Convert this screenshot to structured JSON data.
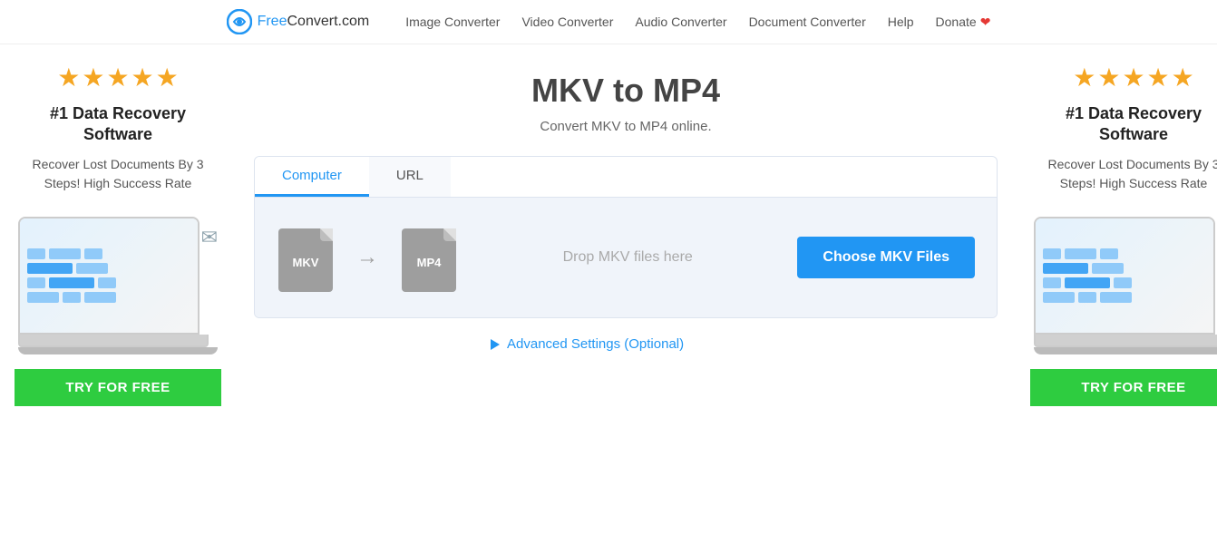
{
  "header": {
    "logo": {
      "free": "Free",
      "convert": "Convert",
      "domain": ".com"
    },
    "nav": {
      "image_converter": "Image Converter",
      "video_converter": "Video Converter",
      "audio_converter": "Audio Converter",
      "document_converter": "Document Converter",
      "help": "Help",
      "donate": "Donate"
    }
  },
  "left_ad": {
    "stars": 4.5,
    "title": "#1 Data Recovery Software",
    "description": "Recover Lost Documents By 3 Steps! High Success Rate",
    "button": "TRY FOR FREE"
  },
  "right_ad": {
    "stars": 4.5,
    "title": "#1 Data Recovery Software",
    "description": "Recover Lost Documents By 3 Steps! High Success Rate",
    "button": "TRY FOR FREE"
  },
  "main": {
    "title": "MKV to MP4",
    "subtitle": "Convert MKV to MP4 online.",
    "tabs": [
      {
        "label": "Computer",
        "active": true
      },
      {
        "label": "URL",
        "active": false
      }
    ],
    "source_format": "MKV",
    "target_format": "MP4",
    "drop_zone_text": "Drop MKV files here",
    "choose_button": "Choose MKV Files",
    "advanced_settings": "Advanced Settings (Optional)"
  }
}
